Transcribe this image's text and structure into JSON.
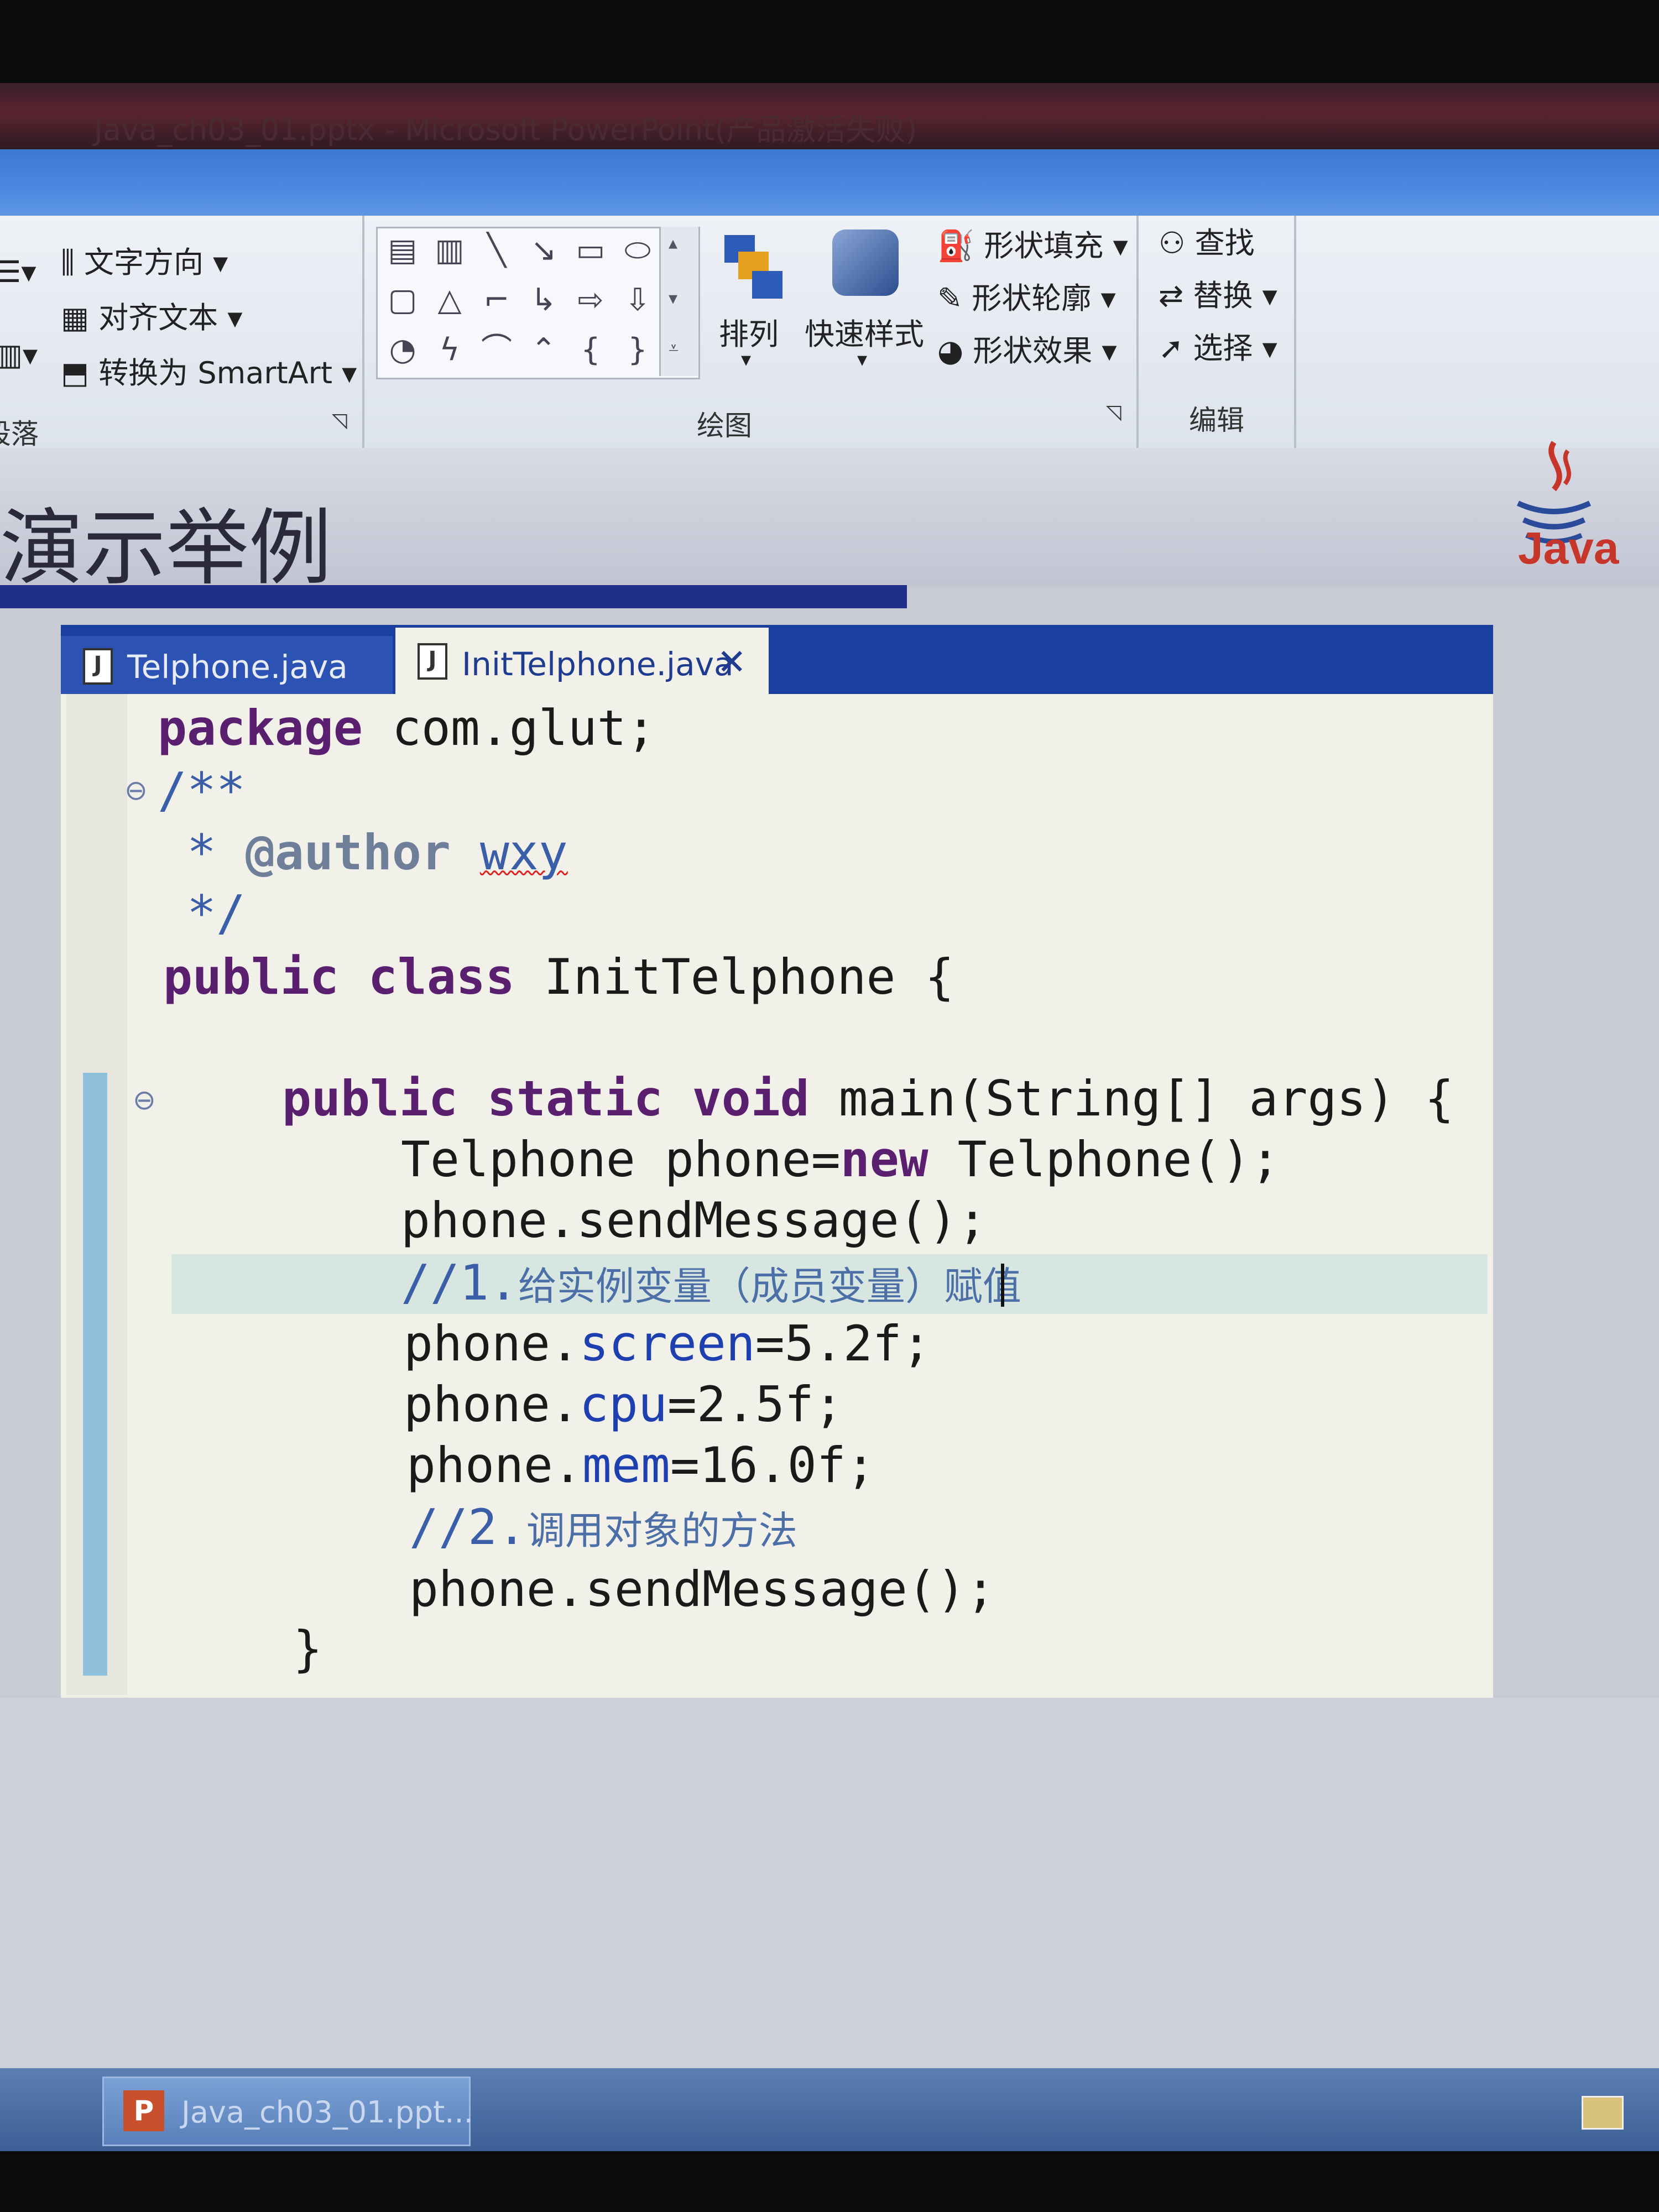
{
  "window": {
    "title": "Java_ch03_01.pptx - Microsoft PowerPoint(产品激活失败)"
  },
  "ribbon": {
    "paragraph_group": {
      "text_direction": "文字方向",
      "align_text": "对齐文本",
      "convert_smartart": "转换为 SmartArt",
      "group_label": "段落"
    },
    "drawing_group": {
      "arrange": "排列",
      "quick_styles": "快速样式",
      "shape_fill": "形状填充",
      "shape_outline": "形状轮廓",
      "shape_effects": "形状效果",
      "group_label": "绘图"
    },
    "editing_group": {
      "find": "查找",
      "replace": "替换",
      "select": "选择",
      "group_label": "编辑"
    }
  },
  "slide": {
    "title": "演示举例",
    "logo_text": "Java",
    "editor": {
      "tabs": [
        {
          "label": "Telphone.java",
          "active": false
        },
        {
          "label": "InitTelphone.java",
          "active": true
        }
      ],
      "code": {
        "l1_kw": "package",
        "l1_rest": " com.glut;",
        "l2": "/**",
        "l3_star": " * ",
        "l3_tag": "@author",
        "l3_name": "wxy",
        "l4": " */",
        "l5_kw": "public class",
        "l5_rest": " InitTelphone {",
        "l6_kw": "public static void",
        "l6_rest": " main(String[] args) {",
        "l7_a": "Telphone phone=",
        "l7_kw": "new",
        "l7_b": " Telphone();",
        "l8": "phone.sendMessage();",
        "l9_slash": "//1.",
        "l9_zh": "给实例变量（成员变量）赋值",
        "l10_a": "phone.",
        "l10_f": "screen",
        "l10_b": "=5.2f;",
        "l11_a": "phone.",
        "l11_f": "cpu",
        "l11_b": "=2.5f;",
        "l12_a": "phone.",
        "l12_f": "mem",
        "l12_b": "=16.0f;",
        "l13_slash": "//2.",
        "l13_zh": "调用对象的方法",
        "l14": "phone.sendMessage();",
        "l15": "}"
      }
    }
  },
  "taskbar": {
    "item_label": "Java_ch03_01.ppt...",
    "item_icon_text": "P"
  },
  "colors": {
    "ribbon_bg": "#e6eaf1",
    "title_underline": "#1f2f8a",
    "tab_strip": "#1b3f9e",
    "editor_bg": "#f1f1ea",
    "keyword": "#5a1f6e",
    "comment": "#3a5fa8",
    "field": "#1d3fb0"
  }
}
